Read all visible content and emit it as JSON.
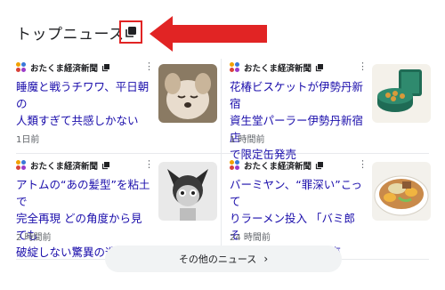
{
  "header": {
    "title": "トップニュース"
  },
  "colors": {
    "highlight": "#e12424",
    "link": "#1a0dab",
    "muted": "#5f6368"
  },
  "cards": [
    {
      "source": "おたくま経済新聞",
      "headline": "睡魔と戦うチワワ、平日朝の\n人類すぎて共感しかない",
      "time": "1日前",
      "thumb": "chihuahua-photo"
    },
    {
      "source": "おたくま経済新聞",
      "headline": "花椿ビスケットが伊勢丹新宿\n資生堂パーラー伊勢丹新宿店\nで限定缶発売",
      "time": "1 時間前",
      "thumb": "biscuit-tin-photo"
    },
    {
      "source": "おたくま経済新聞",
      "headline": "アトムの“あの髪型”を粘土で\n完全再現 どの角度から見ても\n破綻しない驚異の造形",
      "time": "2 時間前",
      "thumb": "astro-boy-clay-photo"
    },
    {
      "source": "おたくま経済新聞",
      "headline": "バーミヤン、“罪深い”こって\nりラーメン投入 「バミ郎そ\nば」など期間限定販売",
      "time": "24 時間前",
      "thumb": "ramen-photo"
    }
  ],
  "footer": {
    "more_label": "その他のニュース"
  }
}
